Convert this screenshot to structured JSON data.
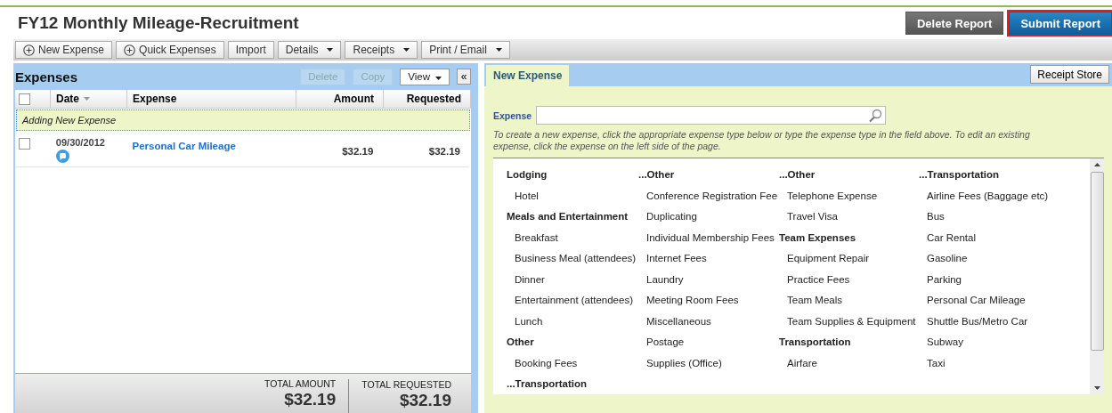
{
  "title": "FY12 Monthly Mileage-Recruitment",
  "header_buttons": [
    {
      "label": "Delete Report",
      "kind": "secondary",
      "highlighted": false
    },
    {
      "label": "Submit Report",
      "kind": "primary",
      "highlighted": true
    }
  ],
  "toolbar": [
    {
      "label": "New Expense",
      "kind": "add"
    },
    {
      "label": "Quick Expenses",
      "kind": "add"
    },
    {
      "label": "Import",
      "kind": "plain"
    },
    {
      "label": "Details",
      "kind": "menu"
    },
    {
      "label": "Receipts",
      "kind": "menu"
    },
    {
      "label": "Print / Email",
      "kind": "menu"
    }
  ],
  "expenses": {
    "title": "Expenses",
    "actions": [
      {
        "label": "Delete",
        "disabled": true,
        "kind": "plain"
      },
      {
        "label": "Copy",
        "disabled": true,
        "kind": "plain"
      },
      {
        "label": "View",
        "disabled": false,
        "kind": "menu"
      }
    ],
    "collapse": "«",
    "select_all_checked": false,
    "columns": [
      "Date",
      "Expense",
      "Amount",
      "Requested"
    ],
    "adding_row": "Adding New Expense",
    "rows": [
      {
        "date": "09/30/2012",
        "expense": "Personal Car Mileage",
        "amount": "$32.19",
        "requested": "$32.19",
        "checked": false,
        "has_comment": true
      }
    ],
    "totals": [
      {
        "label": "TOTAL AMOUNT",
        "value": "$32.19"
      },
      {
        "label": "TOTAL REQUESTED",
        "value": "$32.19"
      }
    ]
  },
  "new_expense": {
    "tab": {
      "label": "New Expense",
      "selected": true
    },
    "receipt_store": "Receipt Store",
    "field_label": "Expense",
    "hint": "To create a new expense, click the appropriate expense type below or type the expense type in the field above. To edit an existing expense, click the expense on the left side of the page.",
    "type_columns": [
      [
        {
          "label": "Lodging",
          "kind": "heading"
        },
        {
          "label": "Hotel",
          "kind": "item"
        },
        {
          "label": "Meals and Entertainment",
          "kind": "heading"
        },
        {
          "label": "Breakfast",
          "kind": "item"
        },
        {
          "label": "Business Meal (attendees)",
          "kind": "item"
        },
        {
          "label": "Dinner",
          "kind": "item"
        },
        {
          "label": "Entertainment (attendees)",
          "kind": "item"
        },
        {
          "label": "Lunch",
          "kind": "item"
        },
        {
          "label": "Other",
          "kind": "heading"
        },
        {
          "label": "Booking Fees",
          "kind": "item"
        },
        {
          "label": "...Transportation",
          "kind": "heading"
        }
      ],
      [
        {
          "label": "...Other",
          "kind": "heading"
        },
        {
          "label": "Conference Registration Fee",
          "kind": "item"
        },
        {
          "label": "Duplicating",
          "kind": "item"
        },
        {
          "label": "Individual Membership Fees",
          "kind": "item"
        },
        {
          "label": "Internet Fees",
          "kind": "item"
        },
        {
          "label": "Laundry",
          "kind": "item"
        },
        {
          "label": "Meeting Room Fees",
          "kind": "item"
        },
        {
          "label": "Miscellaneous",
          "kind": "item"
        },
        {
          "label": "Postage",
          "kind": "item"
        },
        {
          "label": "Supplies (Office)",
          "kind": "item"
        }
      ],
      [
        {
          "label": "...Other",
          "kind": "heading"
        },
        {
          "label": "Telephone Expense",
          "kind": "item"
        },
        {
          "label": "Travel Visa",
          "kind": "item"
        },
        {
          "label": "Team Expenses",
          "kind": "heading"
        },
        {
          "label": "Equipment Repair",
          "kind": "item"
        },
        {
          "label": "Practice Fees",
          "kind": "item"
        },
        {
          "label": "Team Meals",
          "kind": "item"
        },
        {
          "label": "Team Supplies & Equipment",
          "kind": "item"
        },
        {
          "label": "Transportation",
          "kind": "heading"
        },
        {
          "label": "Airfare",
          "kind": "item"
        }
      ],
      [
        {
          "label": "...Transportation",
          "kind": "heading"
        },
        {
          "label": "Airline Fees (Baggage etc)",
          "kind": "item"
        },
        {
          "label": "Bus",
          "kind": "item"
        },
        {
          "label": "Car Rental",
          "kind": "item"
        },
        {
          "label": "Gasoline",
          "kind": "item"
        },
        {
          "label": "Parking",
          "kind": "item"
        },
        {
          "label": "Personal Car Mileage",
          "kind": "item"
        },
        {
          "label": "Shuttle Bus/Metro Car",
          "kind": "item"
        },
        {
          "label": "Subway",
          "kind": "item"
        },
        {
          "label": "Taxi",
          "kind": "item"
        }
      ]
    ]
  }
}
